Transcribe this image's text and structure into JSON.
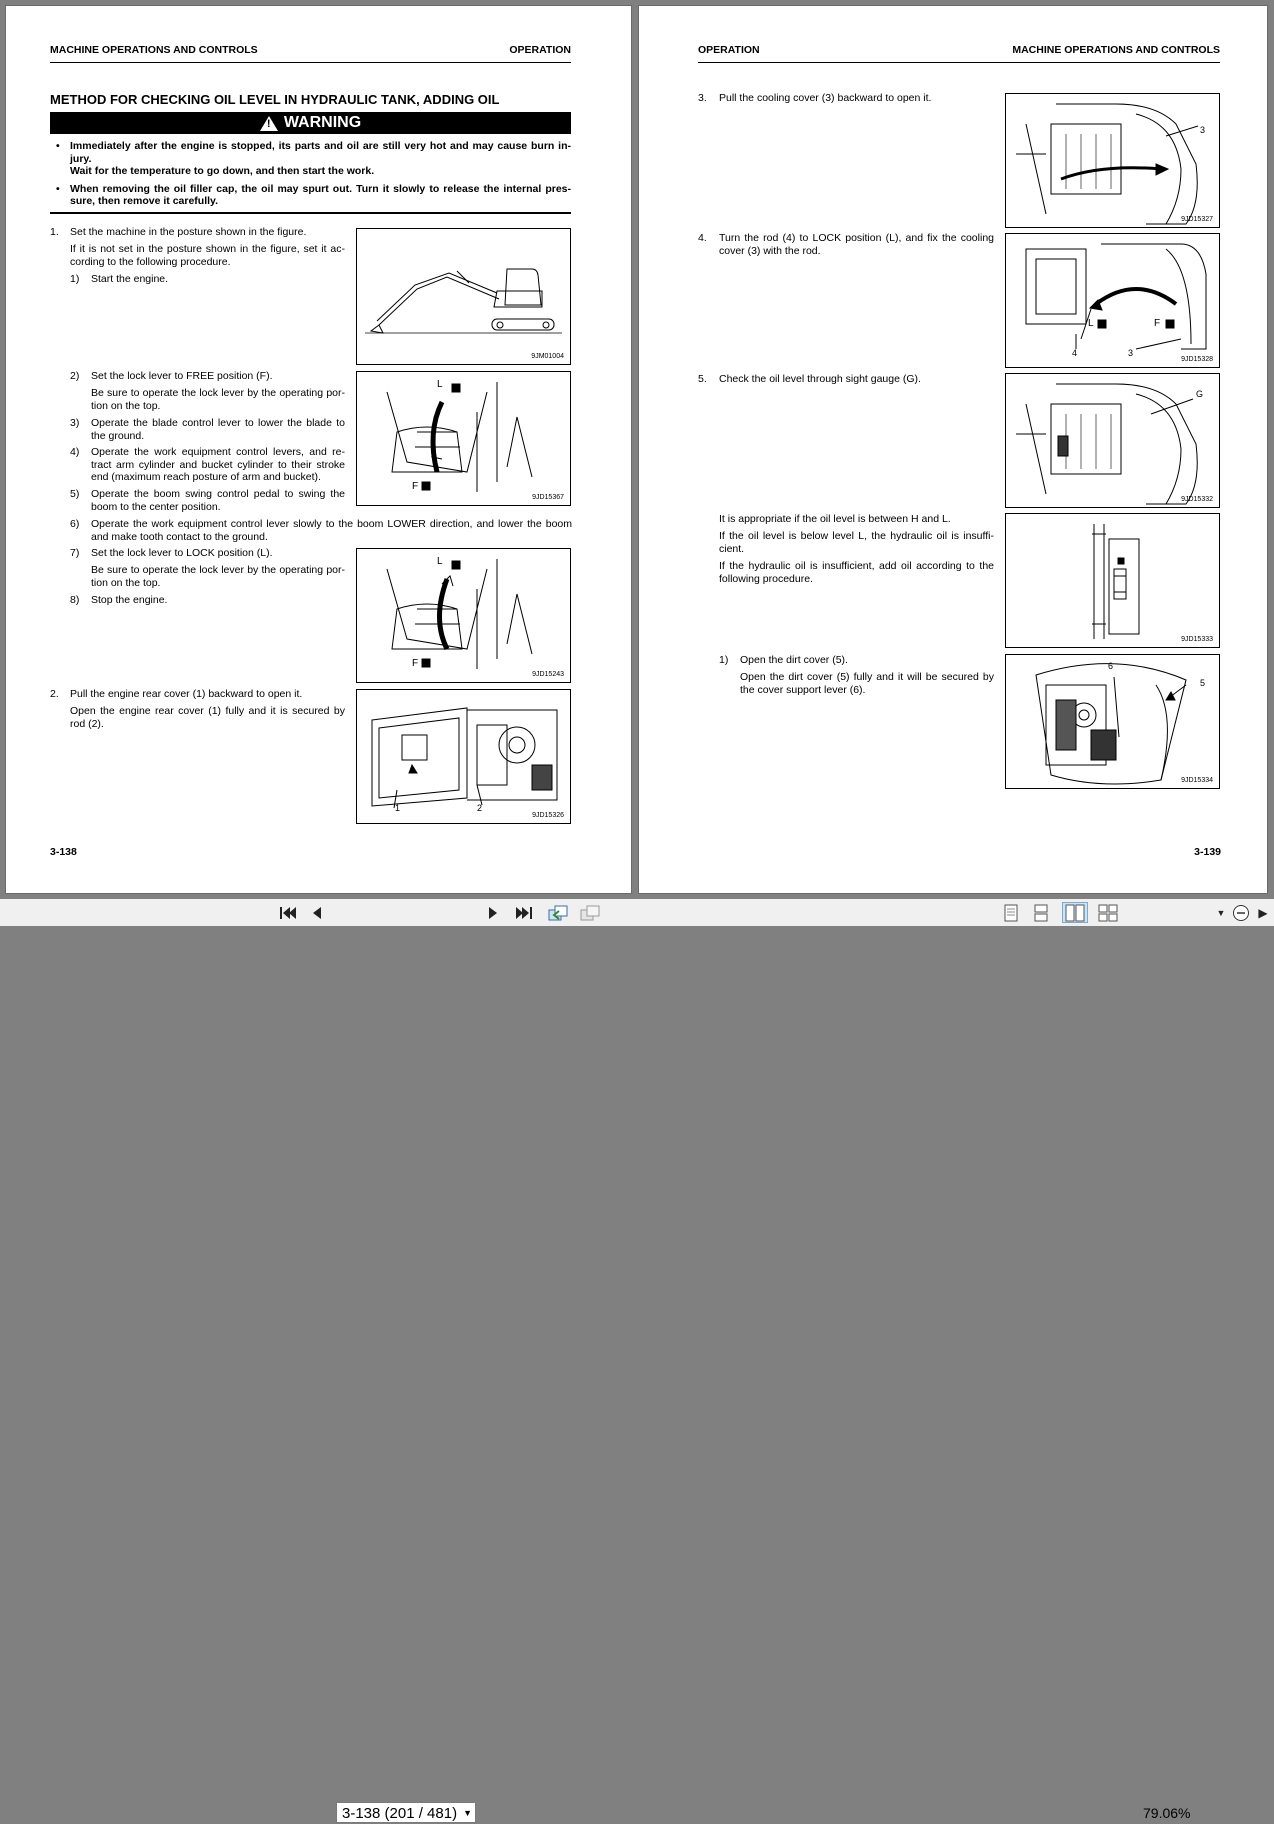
{
  "left": {
    "header_left": "MACHINE OPERATIONS AND CONTROLS",
    "header_right": "OPERATION",
    "title": "METHOD FOR CHECKING OIL LEVEL IN HYDRAULIC TANK, ADDING OIL",
    "warning_label": "WARNING",
    "warnings": [
      "Immediately after the engine is stopped, its parts and oil are still very hot and may cause burn in-jury.",
      "Wait for the temperature to go down, and then start the work.",
      "When removing the oil filler cap, the oil may spurt out. Turn it slowly to release the internal pres-sure, then remove it carefully."
    ],
    "step1_num": "1.",
    "step1_title": "Set the machine in the posture shown in the figure.",
    "step1_body": "If it is not set in the posture shown in the figure, set it ac-cording to the following procedure.",
    "substeps": [
      {
        "n": "1)",
        "text": "Start the engine."
      },
      {
        "n": "2)",
        "text": "Set the lock lever to FREE position (F)."
      },
      {
        "n": "",
        "text": "Be sure to operate the lock lever by the operating por-tion on the top."
      },
      {
        "n": "3)",
        "text": "Operate the blade control lever to lower the blade to the ground."
      },
      {
        "n": "4)",
        "text": "Operate the work equipment control levers, and re-tract arm cylinder and bucket cylinder to their stroke end (maximum reach posture of arm and bucket)."
      },
      {
        "n": "5)",
        "text": "Operate the boom swing control pedal to swing the boom to the center position."
      },
      {
        "n": "6)",
        "text": "Operate the work equipment control lever slowly to the boom LOWER direction, and lower the boom and make tooth contact to the ground."
      },
      {
        "n": "7)",
        "text": "Set the lock lever to LOCK position (L)."
      },
      {
        "n": "",
        "text": "Be sure to operate the lock lever by the operating por-tion on the top."
      },
      {
        "n": "8)",
        "text": "Stop the engine."
      }
    ],
    "step2_num": "2.",
    "step2_title": "Pull the engine rear cover (1) backward to open it.",
    "step2_body": "Open the engine rear cover (1) fully and it is secured by rod (2).",
    "figs": [
      "9JM01004",
      "9JD15367",
      "9JD15243",
      "9JD15326"
    ],
    "page_number": "3-138"
  },
  "right": {
    "header_left": "OPERATION",
    "header_right": "MACHINE OPERATIONS AND CONTROLS",
    "step3_num": "3.",
    "step3": "Pull the cooling cover (3) backward to open it.",
    "step4_num": "4.",
    "step4": "Turn the rod (4) to LOCK position (L), and fix the cooling cover (3) with the rod.",
    "step5_num": "5.",
    "step5": "Check the oil level through sight gauge (G).",
    "level_text": [
      "It is appropriate if the oil level is between H and L.",
      "If the oil level is below level L, the hydraulic oil is insuffi-cient.",
      "If the hydraulic oil is insufficient, add oil according to the following procedure."
    ],
    "sub1_num": "1)",
    "sub1_title": "Open the dirt cover (5).",
    "sub1_body": "Open the dirt cover (5) fully and it will be secured by the cover support lever (6).",
    "figs": [
      "9JD15327",
      "9JD15328",
      "9JD15332",
      "9JD15333",
      "9JD15334"
    ],
    "page_number": "3-139"
  },
  "toolbar": {
    "page_field": "3-138 (201 / 481)",
    "zoom": "79.06%"
  }
}
